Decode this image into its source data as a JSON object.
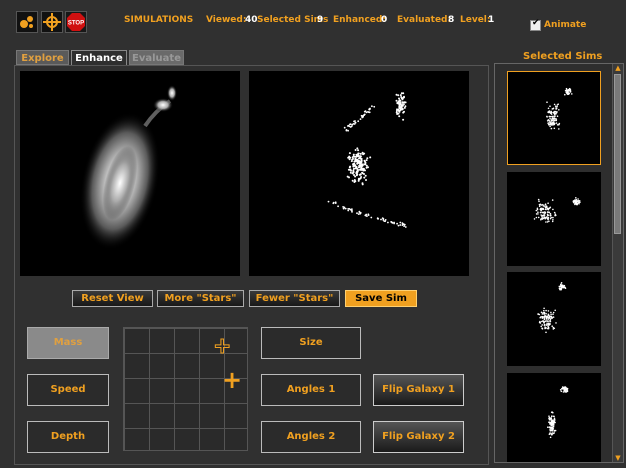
{
  "topbar": {
    "icons": [
      "stars-icon",
      "target-icon",
      "stop-icon"
    ],
    "stop_label": "STOP",
    "title": "SIMULATIONS",
    "viewed_label": "Viewed:",
    "viewed": "40",
    "selected_label": "Selected Sims",
    "selected": "9",
    "enhanced_label": "Enhanced:",
    "enhanced": "0",
    "evaluated_label": "Evaluated:",
    "evaluated": "8",
    "level_label": "Level:",
    "level": "1",
    "animate_label": "Animate",
    "animate_checked": true
  },
  "tabs": [
    {
      "label": "Explore",
      "active": false
    },
    {
      "label": "Enhance",
      "active": true
    },
    {
      "label": "Evaluate",
      "active": false
    }
  ],
  "actions": {
    "reset": "Reset View",
    "more": "More \"Stars\"",
    "fewer": "Fewer \"Stars\"",
    "save": "Save Sim"
  },
  "params": {
    "mass": "Mass",
    "speed": "Speed",
    "depth": "Depth",
    "size": "Size",
    "angles1": "Angles 1",
    "angles2": "Angles 2",
    "flip1": "Flip Galaxy 1",
    "flip2": "Flip Galaxy 2"
  },
  "selected_panel": {
    "title": "Selected Sims",
    "thumbnails": 4
  },
  "colors": {
    "accent": "#f0a020",
    "background": "#303030"
  }
}
